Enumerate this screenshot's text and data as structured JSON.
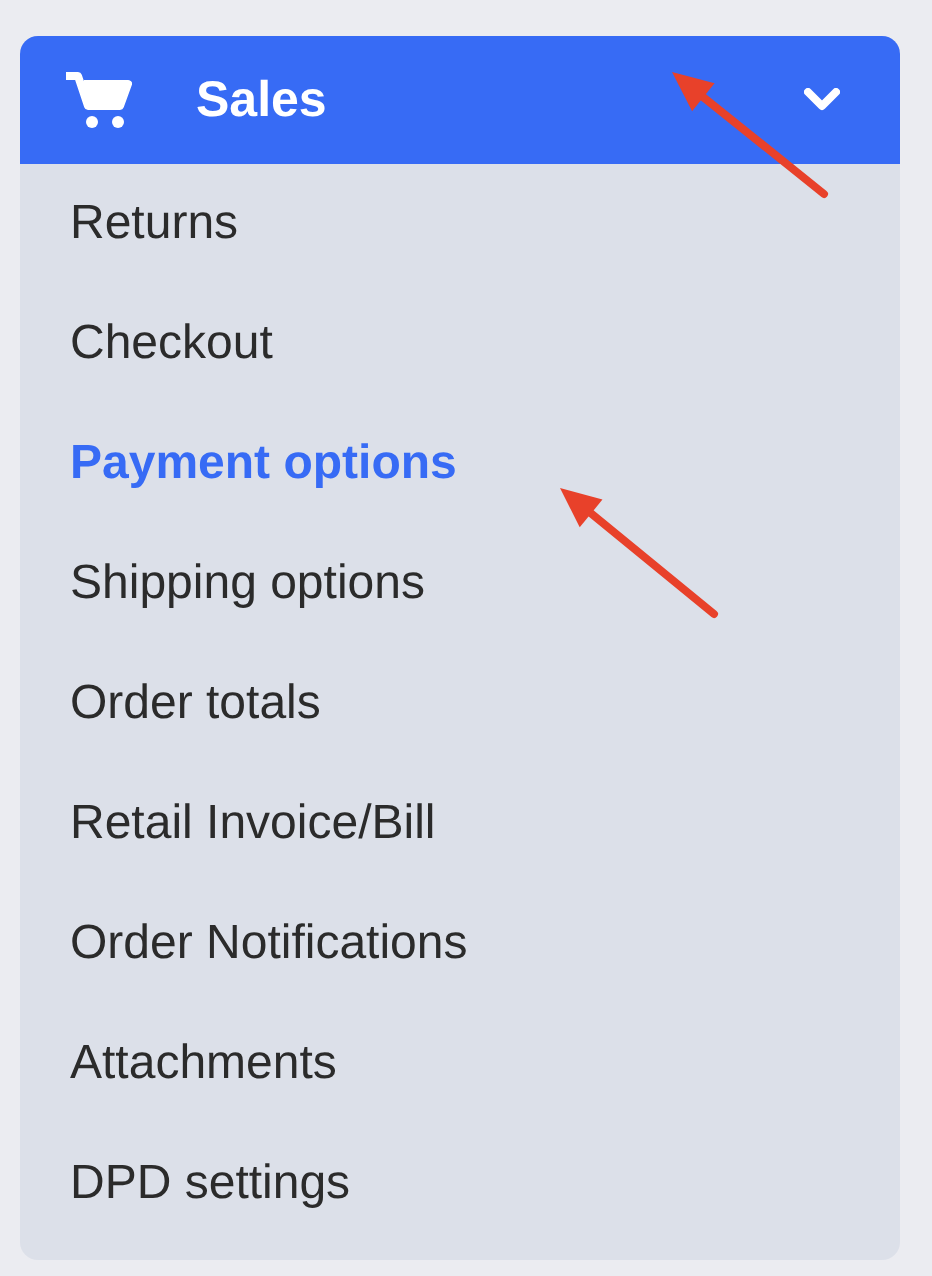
{
  "menu": {
    "title": "Sales",
    "expanded": true,
    "items": [
      {
        "label": "Returns",
        "selected": false
      },
      {
        "label": "Checkout",
        "selected": false
      },
      {
        "label": "Payment options",
        "selected": true
      },
      {
        "label": "Shipping options",
        "selected": false
      },
      {
        "label": "Order totals",
        "selected": false
      },
      {
        "label": "Retail Invoice/Bill",
        "selected": false
      },
      {
        "label": "Order Notifications",
        "selected": false
      },
      {
        "label": "Attachments",
        "selected": false
      },
      {
        "label": "DPD settings",
        "selected": false
      }
    ]
  }
}
